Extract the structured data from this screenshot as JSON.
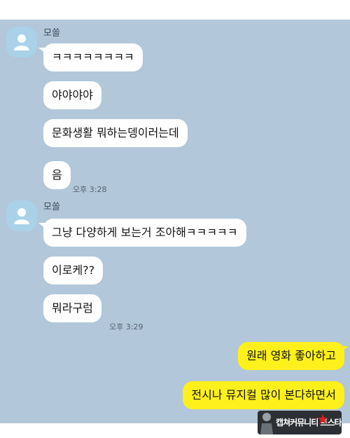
{
  "colors": {
    "chat_background": "#b2c7d9",
    "incoming_bubble": "#ffffff",
    "outgoing_bubble": "#fef01b",
    "avatar": "#a9d2e9"
  },
  "groups": [
    {
      "sender": "모쏠",
      "avatar_icon": "default-profile-icon",
      "messages": [
        "ㅋㅋㅋㅋㅋㅋㅋㅋ",
        "야야야야",
        "문화생활 뭐하는뎅이러는데",
        "음"
      ],
      "time": "오후 3:28"
    },
    {
      "sender": "모쏠",
      "avatar_icon": "default-profile-icon",
      "messages": [
        "그냥 다양하게 보는거 조아해ㅋㅋㅋㅋㅋ",
        "이로케??",
        "뭐라구럼"
      ],
      "time": "오후 3:29"
    }
  ],
  "outgoing": {
    "messages": [
      "원래 영화 좋아하고",
      "전시나 뮤지컬 많이 본다하면서"
    ]
  },
  "watermark": {
    "text": "캡쳐커뮤니티 트스타"
  }
}
